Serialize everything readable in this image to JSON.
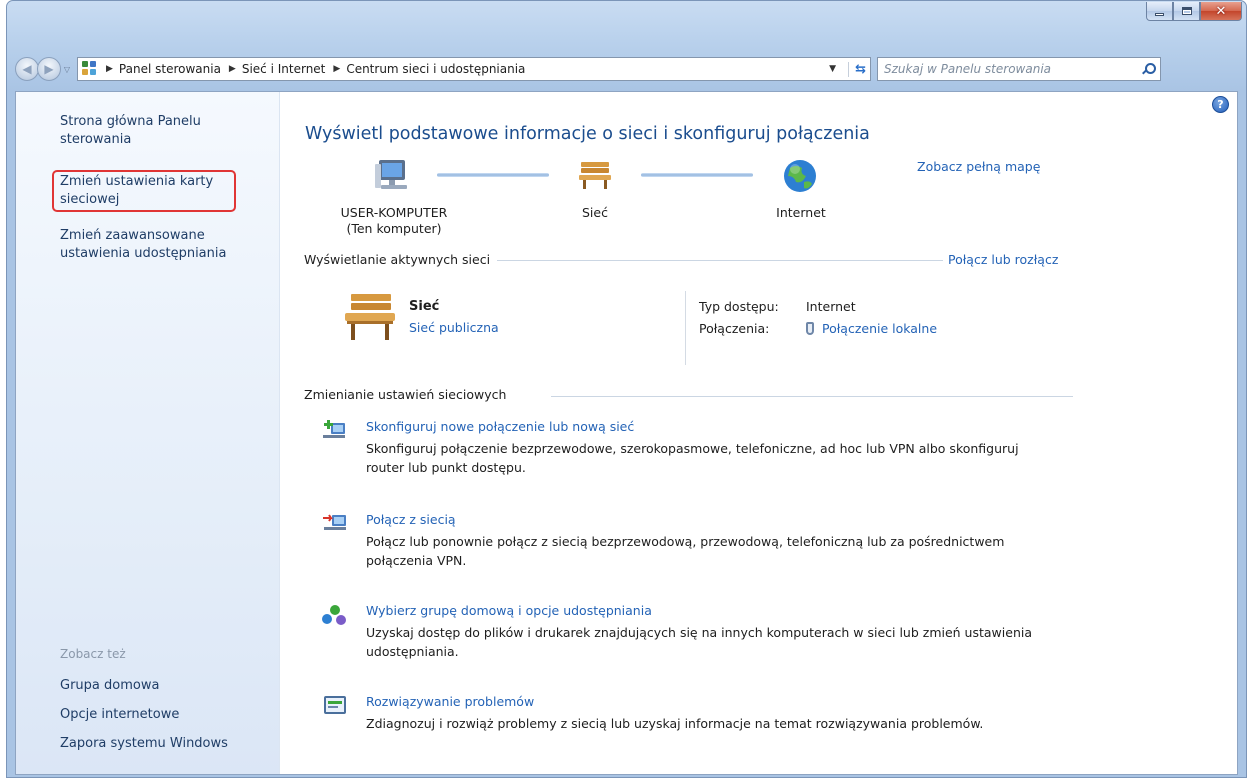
{
  "window": {
    "caption": {
      "minimize": "–",
      "maximize": "□",
      "close": "✕"
    }
  },
  "address": {
    "crumbs": [
      "Panel sterowania",
      "Sieć i Internet",
      "Centrum sieci i udostępniania"
    ],
    "search_placeholder": "Szukaj w Panelu sterowania"
  },
  "sidebar": {
    "links": [
      "Strona główna Panelu sterowania",
      "Zmień ustawienia karty sieciowej",
      "Zmień zaawansowane ustawienia udostępniania"
    ],
    "see_also_label": "Zobacz też",
    "see_also": [
      "Grupa domowa",
      "Opcje internetowe",
      "Zapora systemu Windows"
    ]
  },
  "main": {
    "title": "Wyświetl podstawowe informacje o sieci i skonfiguruj połączenia",
    "full_map_link": "Zobacz pełną mapę",
    "map": {
      "computer_name": "USER-KOMPUTER",
      "computer_sub": "(Ten komputer)",
      "network": "Sieć",
      "internet": "Internet"
    },
    "active": {
      "heading": "Wyświetlanie aktywnych sieci",
      "connect_link": "Połącz lub rozłącz",
      "network_name": "Sieć",
      "network_type": "Sieć publiczna",
      "access_label": "Typ dostępu:",
      "access_value": "Internet",
      "connections_label": "Połączenia:",
      "connections_value": "Połączenie lokalne"
    },
    "change": {
      "heading": "Zmienianie ustawień sieciowych",
      "tasks": [
        {
          "title": "Skonfiguruj nowe połączenie lub nową sieć",
          "desc": "Skonfiguruj połączenie bezprzewodowe, szerokopasmowe, telefoniczne, ad hoc lub VPN albo skonfiguruj router lub punkt dostępu."
        },
        {
          "title": "Połącz z siecią",
          "desc": "Połącz lub ponownie połącz z siecią bezprzewodową, przewodową, telefoniczną lub za pośrednictwem połączenia VPN."
        },
        {
          "title": "Wybierz grupę domową i opcje udostępniania",
          "desc": "Uzyskaj dostęp do plików i drukarek znajdujących się na innych komputerach w sieci lub zmień ustawienia udostępniania."
        },
        {
          "title": "Rozwiązywanie problemów",
          "desc": "Zdiagnozuj i rozwiąż problemy z siecią lub uzyskaj informacje na temat rozwiązywania problemów."
        }
      ]
    }
  },
  "help": "?"
}
